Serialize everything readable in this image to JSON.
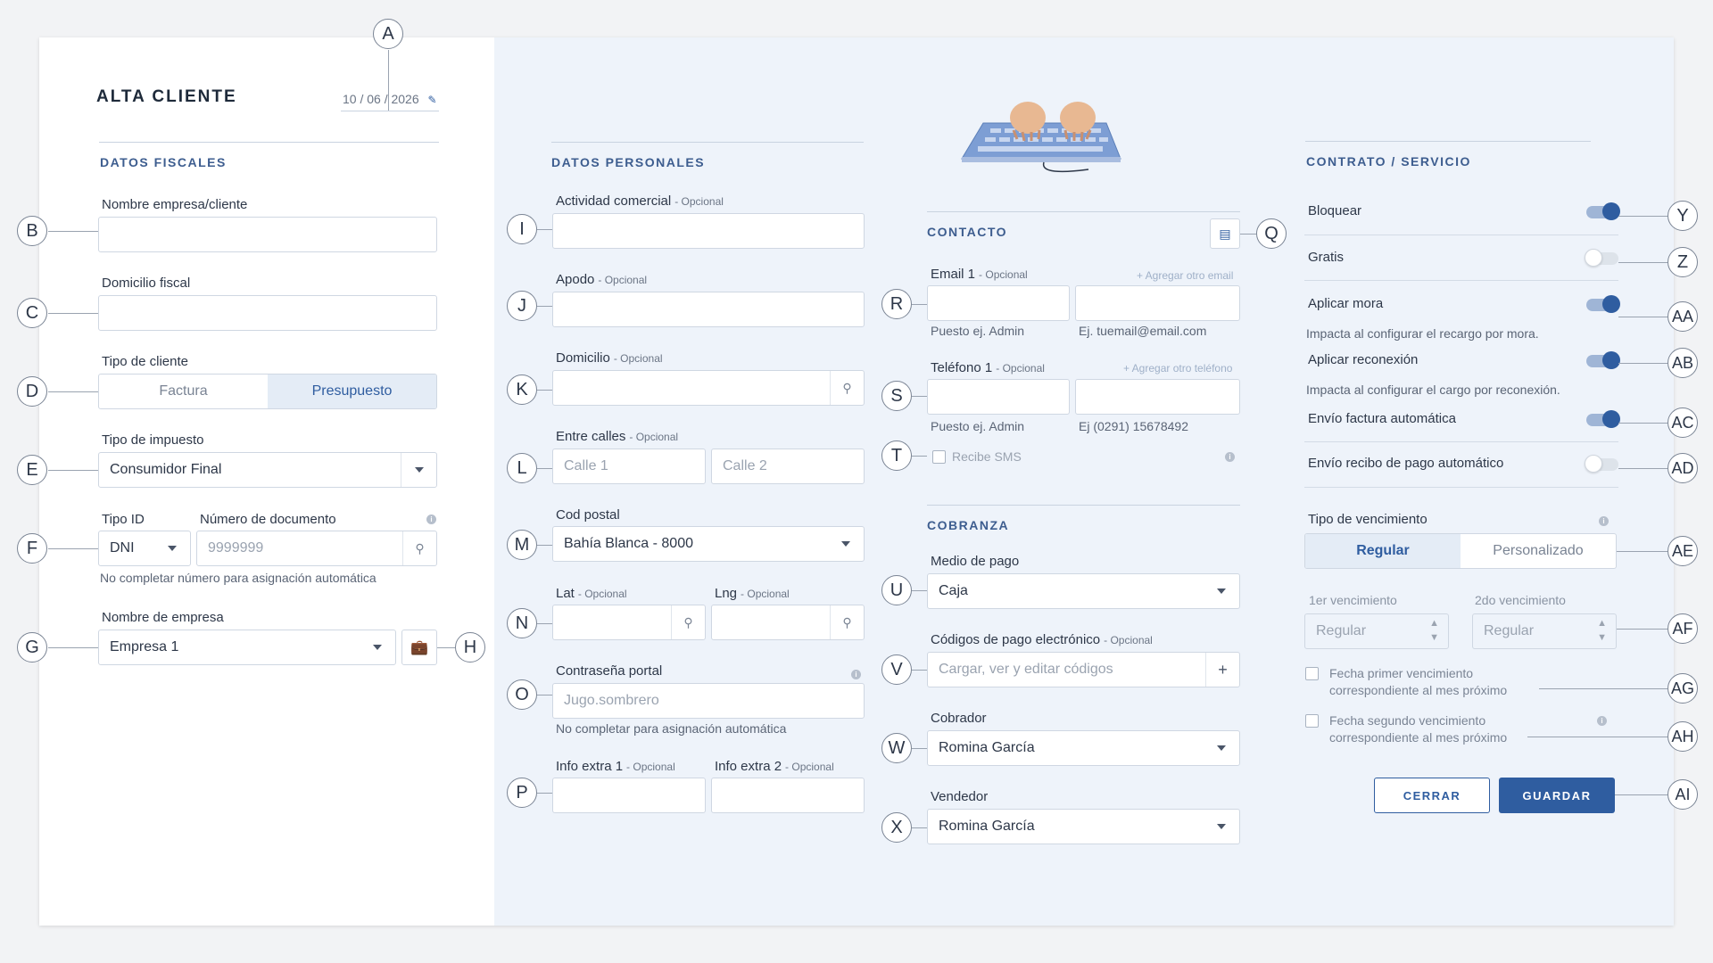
{
  "header": {
    "title": "ALTA CLIENTE",
    "date": "10 / 06 / 2026"
  },
  "fiscal": {
    "section": "DATOS FISCALES",
    "nombre_label": "Nombre empresa/cliente",
    "domicilio_label": "Domicilio fiscal",
    "tipo_cliente_label": "Tipo de cliente",
    "tipo_cliente_options": [
      "Factura",
      "Presupuesto"
    ],
    "tipo_impuesto_label": "Tipo de impuesto",
    "tipo_impuesto_value": "Consumidor Final",
    "tipo_id_label": "Tipo ID",
    "tipo_id_value": "DNI",
    "documento_label": "Número de documento",
    "documento_placeholder": "9999999",
    "documento_hint": "No completar número para asignación automática",
    "empresa_label": "Nombre de empresa",
    "empresa_value": "Empresa 1"
  },
  "personal": {
    "section": "DATOS PERSONALES",
    "optional": "- Opcional",
    "actividad_label": "Actividad comercial",
    "apodo_label": "Apodo",
    "domicilio_label": "Domicilio",
    "entre_calles_label": "Entre calles",
    "calle1_placeholder": "Calle 1",
    "calle2_placeholder": "Calle 2",
    "cp_label": "Cod postal",
    "cp_value": "Bahía Blanca - 8000",
    "lat_label": "Lat",
    "lng_label": "Lng",
    "pass_label": "Contraseña portal",
    "pass_placeholder": "Jugo.sombrero",
    "pass_hint": "No completar para asignación automática",
    "info1_label": "Info extra 1",
    "info2_label": "Info extra 2"
  },
  "contacto": {
    "section": "CONTACTO",
    "email_label": "Email 1",
    "email_add": "+ Agregar otro email",
    "email_hint1": "Puesto ej. Admin",
    "email_hint2": "Ej. tuemail@email.com",
    "tel_label": "Teléfono 1",
    "tel_add": "+ Agregar otro teléfono",
    "tel_hint1": "Puesto ej. Admin",
    "tel_hint2": "Ej (0291) 15678492",
    "sms_label": "Recibe SMS"
  },
  "cobranza": {
    "section": "COBRANZA",
    "medio_label": "Medio de pago",
    "medio_value": "Caja",
    "codigos_label": "Códigos de pago electrónico",
    "codigos_placeholder": "Cargar, ver y editar códigos",
    "cobrador_label": "Cobrador",
    "cobrador_value": "Romina García",
    "vendedor_label": "Vendedor",
    "vendedor_value": "Romina García"
  },
  "contrato": {
    "section": "CONTRATO / SERVICIO",
    "toggles": [
      {
        "label": "Bloquear",
        "on": true
      },
      {
        "label": "Gratis",
        "on": false
      },
      {
        "label": "Aplicar mora",
        "on": true,
        "hint": "Impacta al configurar el recargo por mora."
      },
      {
        "label": "Aplicar reconexión",
        "on": true,
        "hint": "Impacta al configurar el cargo por reconexión."
      },
      {
        "label": "Envío factura automática",
        "on": true
      },
      {
        "label": "Envío recibo de pago automático",
        "on": false
      }
    ],
    "venc_label": "Tipo de vencimiento",
    "venc_options": [
      "Regular",
      "Personalizado"
    ],
    "venc1_label": "1er vencimiento",
    "venc2_label": "2do vencimiento",
    "venc_placeholder": "Regular",
    "check1_line1": "Fecha primer vencimiento",
    "check1_line2": "correspondiente al mes próximo",
    "check2_line1": "Fecha segundo vencimiento",
    "check2_line2": "correspondiente al mes próximo",
    "cerrar": "CERRAR",
    "guardar": "GUARDAR"
  },
  "markers": [
    "A",
    "B",
    "C",
    "D",
    "E",
    "F",
    "G",
    "H",
    "I",
    "J",
    "K",
    "L",
    "M",
    "N",
    "O",
    "P",
    "Q",
    "R",
    "S",
    "T",
    "U",
    "V",
    "W",
    "X",
    "Y",
    "Z",
    "AA",
    "AB",
    "AC",
    "AD",
    "AE",
    "AF",
    "AG",
    "AH",
    "AI"
  ],
  "colors": {
    "accent": "#2f5da0",
    "panel": "#eef3fa"
  }
}
